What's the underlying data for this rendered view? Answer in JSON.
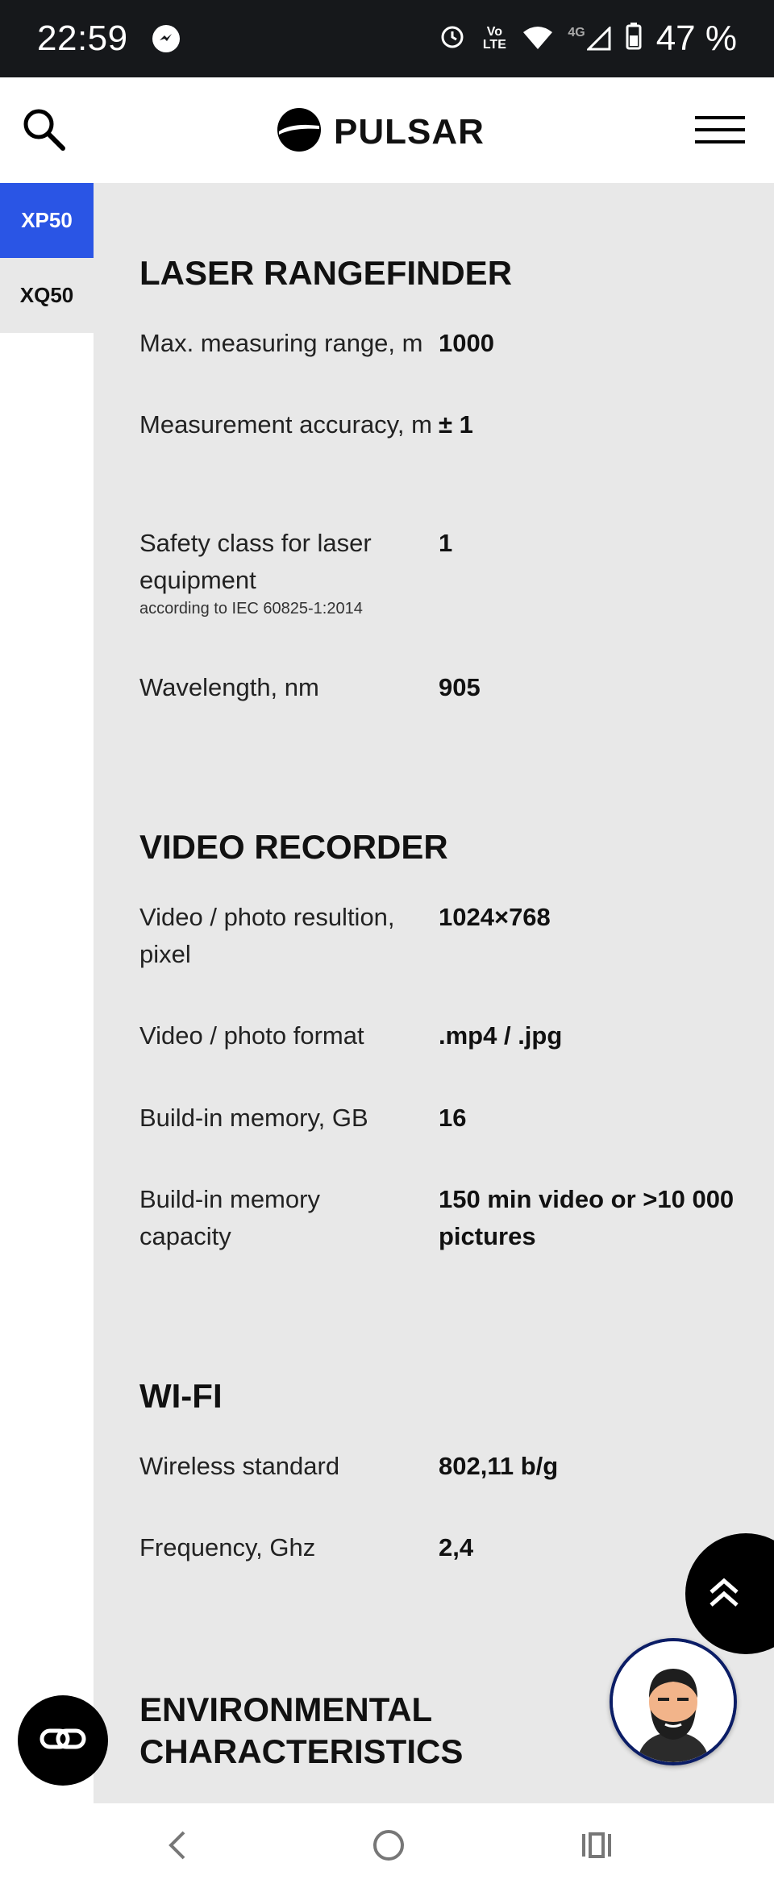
{
  "status_bar": {
    "time": "22:59",
    "signal_small_text": "4G",
    "volte_text": "Vo LTE",
    "battery": "47 %"
  },
  "header": {
    "brand": "PULSAR"
  },
  "tabs": [
    {
      "label": "XP50",
      "active": true
    },
    {
      "label": "XQ50",
      "active": false
    }
  ],
  "sections": {
    "laser": {
      "title": "LASER RANGEFINDER",
      "rows": [
        {
          "label": "Max. measuring range, m",
          "value": "1000"
        },
        {
          "label": "Measurement accuracy, m",
          "value": "± 1"
        },
        {
          "label": "Safety class for laser equipment",
          "note": "according to IEC 60825-1:2014",
          "value": "1"
        },
        {
          "label": "Wavelength, nm",
          "value": "905"
        }
      ]
    },
    "video": {
      "title": "VIDEO RECORDER",
      "rows": [
        {
          "label": "Video / photo resultion, pixel",
          "value": "1024×768"
        },
        {
          "label": "Video / photo format",
          "value": ".mp4 / .jpg"
        },
        {
          "label": "Build-in memory, GB",
          "value": "16"
        },
        {
          "label": "Build-in memory capacity",
          "value": "150 min video or ˃10 000 pictures"
        }
      ]
    },
    "wifi": {
      "title": "WI-FI",
      "rows": [
        {
          "label": "Wireless standard",
          "value": "802,11 b/g"
        },
        {
          "label": "Frequency, Ghz",
          "value": "2,4"
        }
      ]
    },
    "environment": {
      "title": "ENVIRONMENTAL CHARACTERISTICS"
    }
  },
  "icons": {
    "search": "search-icon",
    "menu": "hamburger-menu-icon",
    "scroll_top": "double-chevron-up-icon",
    "chat": "chat-link-icon",
    "avatar": "support-avatar",
    "back": "back-nav-icon",
    "home": "home-nav-icon",
    "recents": "recents-nav-icon"
  },
  "colors": {
    "accent": "#2a55e5",
    "content_bg": "#e8e8e8",
    "status_bar": "#16181b"
  }
}
